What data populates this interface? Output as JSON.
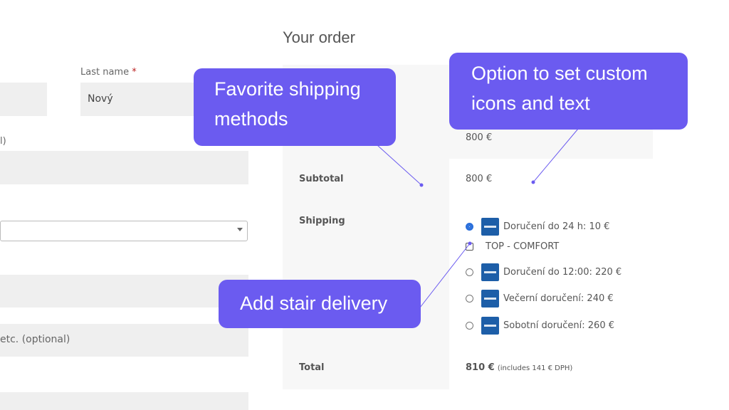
{
  "billing": {
    "last_name_label": "Last name",
    "required_mark": "*",
    "last_name_value": "Nový",
    "partial_label_1": "l)",
    "optional_placeholder": "etc. (optional)"
  },
  "order": {
    "title": "Your order",
    "product_price": "800 €",
    "subtotal_label": "Subtotal",
    "subtotal_value": "800 €",
    "shipping_label": "Shipping",
    "shipping_options": [
      {
        "label": "Doručení do 24 h: 10 €",
        "selected": true,
        "icon": "carrier-logo-icon"
      },
      {
        "label": "TOP - COMFORT",
        "addon": true
      },
      {
        "label": "Doručení do 12:00: 220 €",
        "selected": false,
        "icon": "carrier-logo-icon"
      },
      {
        "label": "Večerní doručení: 240 €",
        "selected": false,
        "icon": "carrier-logo-icon"
      },
      {
        "label": "Sobotní doručení: 260 €",
        "selected": false,
        "icon": "carrier-logo-icon"
      }
    ],
    "total_label": "Total",
    "total_value": "810 €",
    "total_note": "(includes 141 € DPH)"
  },
  "callouts": {
    "favorite": "Favorite shipping methods",
    "custom_icons": "Option to set custom icons and text",
    "stair": "Add stair delivery"
  },
  "colors": {
    "callout_bg": "#6b5bf0",
    "carrier_logo": "#1d5ea8",
    "radio_selected": "#2a6fdb"
  }
}
